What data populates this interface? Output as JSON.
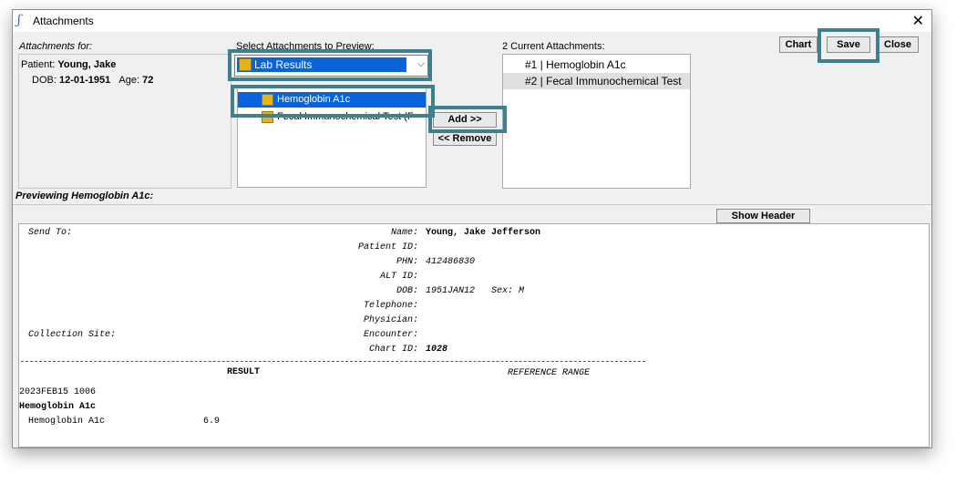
{
  "window": {
    "title": "Attachments"
  },
  "labels": {
    "attachments_for": "Attachments for:",
    "select_to_preview": "Select Attachments to Preview:",
    "current_attachments": "2 Current Attachments:",
    "previewing": "Previewing Hemoglobin A1c:"
  },
  "patient": {
    "name_label": "Patient:",
    "name": "Young, Jake",
    "dob_label": "DOB:",
    "dob": "12-01-1951",
    "age_label": "Age:",
    "age": "72"
  },
  "select": {
    "value": "Lab Results",
    "items": [
      "Hemoglobin A1c",
      "Fecal Immunochemical Test (F"
    ]
  },
  "buttons": {
    "chart": "Chart",
    "save": "Save",
    "close": "Close",
    "add": "Add >>",
    "remove": "<< Remove",
    "show_header": "Show Header"
  },
  "current_attachments": [
    "#1 | Hemoglobin A1c",
    "#2 | Fecal Immunochemical Test"
  ],
  "report": {
    "send_to": "Send To:",
    "collection_site": "Collection Site:",
    "fields": [
      {
        "label": "Name:",
        "value": "Young, Jake Jefferson"
      },
      {
        "label": "Patient ID:",
        "value": ""
      },
      {
        "label": "PHN:",
        "value": "412486830"
      },
      {
        "label": "ALT ID:",
        "value": ""
      },
      {
        "label": "DOB:",
        "value": "1951JAN12   Sex: M"
      },
      {
        "label": "Telephone:",
        "value": ""
      },
      {
        "label": "Physician:",
        "value": ""
      },
      {
        "label": "Encounter:",
        "value": ""
      },
      {
        "label": "Chart ID:",
        "value": "1028"
      }
    ],
    "result_header": "RESULT",
    "reference_header": "REFERENCE RANGE",
    "date": "2023FEB15 1006",
    "group": "Hemoglobin A1c",
    "test_name": "Hemoglobin A1c",
    "test_value": "6.9"
  },
  "colors": {
    "highlight": "#3f7f8e",
    "selection": "#0a63d8"
  },
  "icons": {
    "app": "app-icon",
    "lab": "lab-result-icon"
  }
}
